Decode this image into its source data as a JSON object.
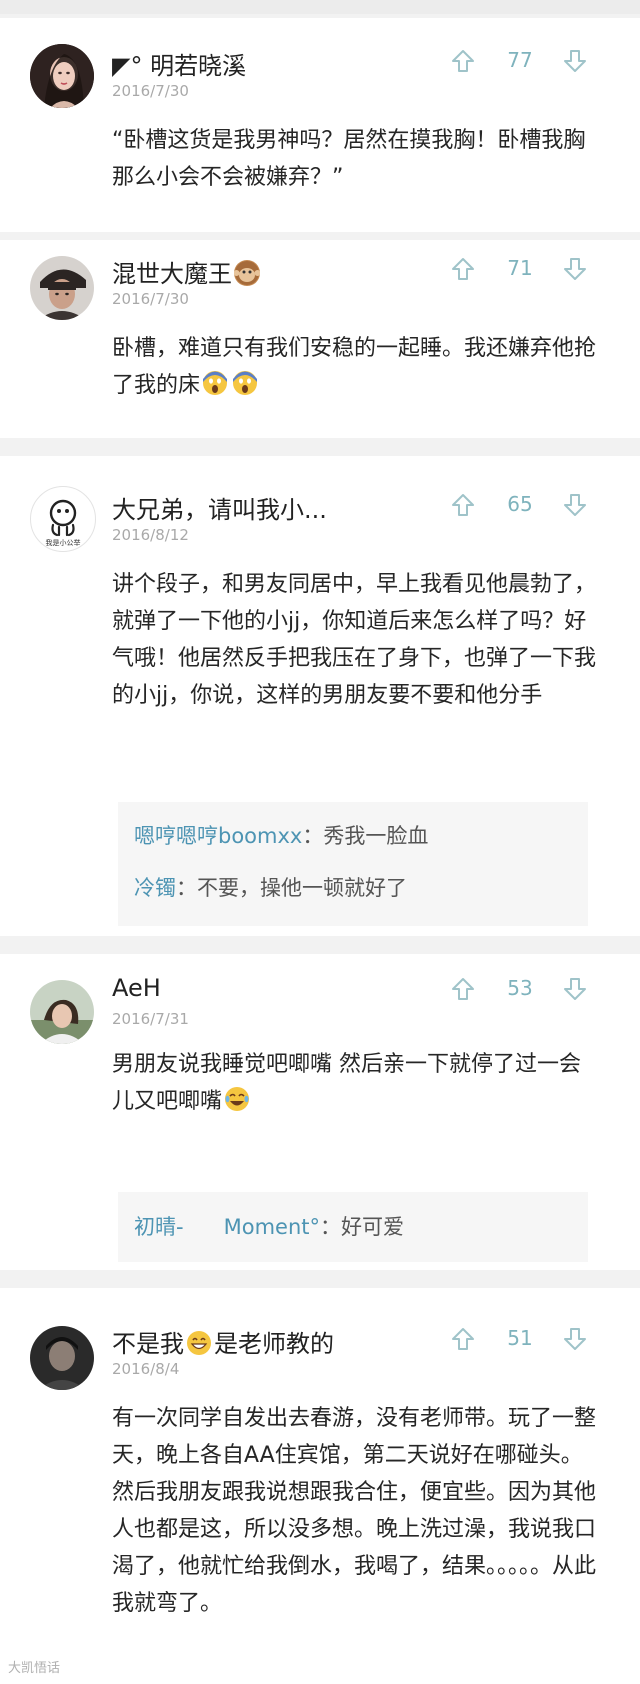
{
  "comments": [
    {
      "username": "◤° 明若晓溪",
      "date": "2016/7/30",
      "votes": "77",
      "content": "“卧槽这货是我男神吗？居然在摸我胸！卧槽我胸那么小会不会被嫌弃？”",
      "avatar_icon": "portrait-woman-avatar"
    },
    {
      "username": "混世大魔王",
      "date": "2016/7/30",
      "votes": "71",
      "content": "卧槽，难道只有我们安稳的一起睡。我还嫌弃他抢了我的床",
      "avatar_icon": "portrait-man-avatar"
    },
    {
      "username": "大兄弟，请叫我小...",
      "date": "2016/8/12",
      "votes": "65",
      "content": "讲个段子，和男友同居中，早上我看见他晨勃了，就弹了一下他的小jj，你知道后来怎么样了吗？好气哦！他居然反手把我压在了身下，也弹了一下我的小jj，你说，这样的男朋友要不要和他分手",
      "avatar_icon": "cartoon-logo-avatar",
      "avatar_caption": "我是小公举",
      "replies": [
        {
          "name": "嗯哼嗯哼boomxx",
          "text": "：秀我一脸血"
        },
        {
          "name": "冷镯",
          "text": "：不要，操他一顿就好了"
        }
      ]
    },
    {
      "username": "AeH",
      "date": "2016/7/31",
      "votes": "53",
      "content": "男朋友说我睡觉吧唧嘴 然后亲一下就停了过一会儿又吧唧嘴",
      "avatar_icon": "portrait-girl-avatar",
      "replies": [
        {
          "name": "初晴-      Moment°",
          "text": "：好可爱"
        }
      ]
    },
    {
      "username_a": "不是我",
      "username_b": "是老师教的",
      "date": "2016/8/4",
      "votes": "51",
      "content": "有一次同学自发出去春游，没有老师带。玩了一整天，晚上各自AA住宾馆，第二天说好在哪碰头。然后我朋友跟我说想跟我合住，便宜些。因为其他人也都是这，所以没多想。晚上洗过澡，我说我口渴了，他就忙给我倒水，我喝了，结果。。。。。从此我就弯了。",
      "avatar_icon": "portrait-dark-avatar"
    }
  ],
  "watermark": "大凯悟话",
  "colors": {
    "vote": "#7fb3bd",
    "reply_name": "#4d94b3",
    "date": "#a9a9a9"
  }
}
